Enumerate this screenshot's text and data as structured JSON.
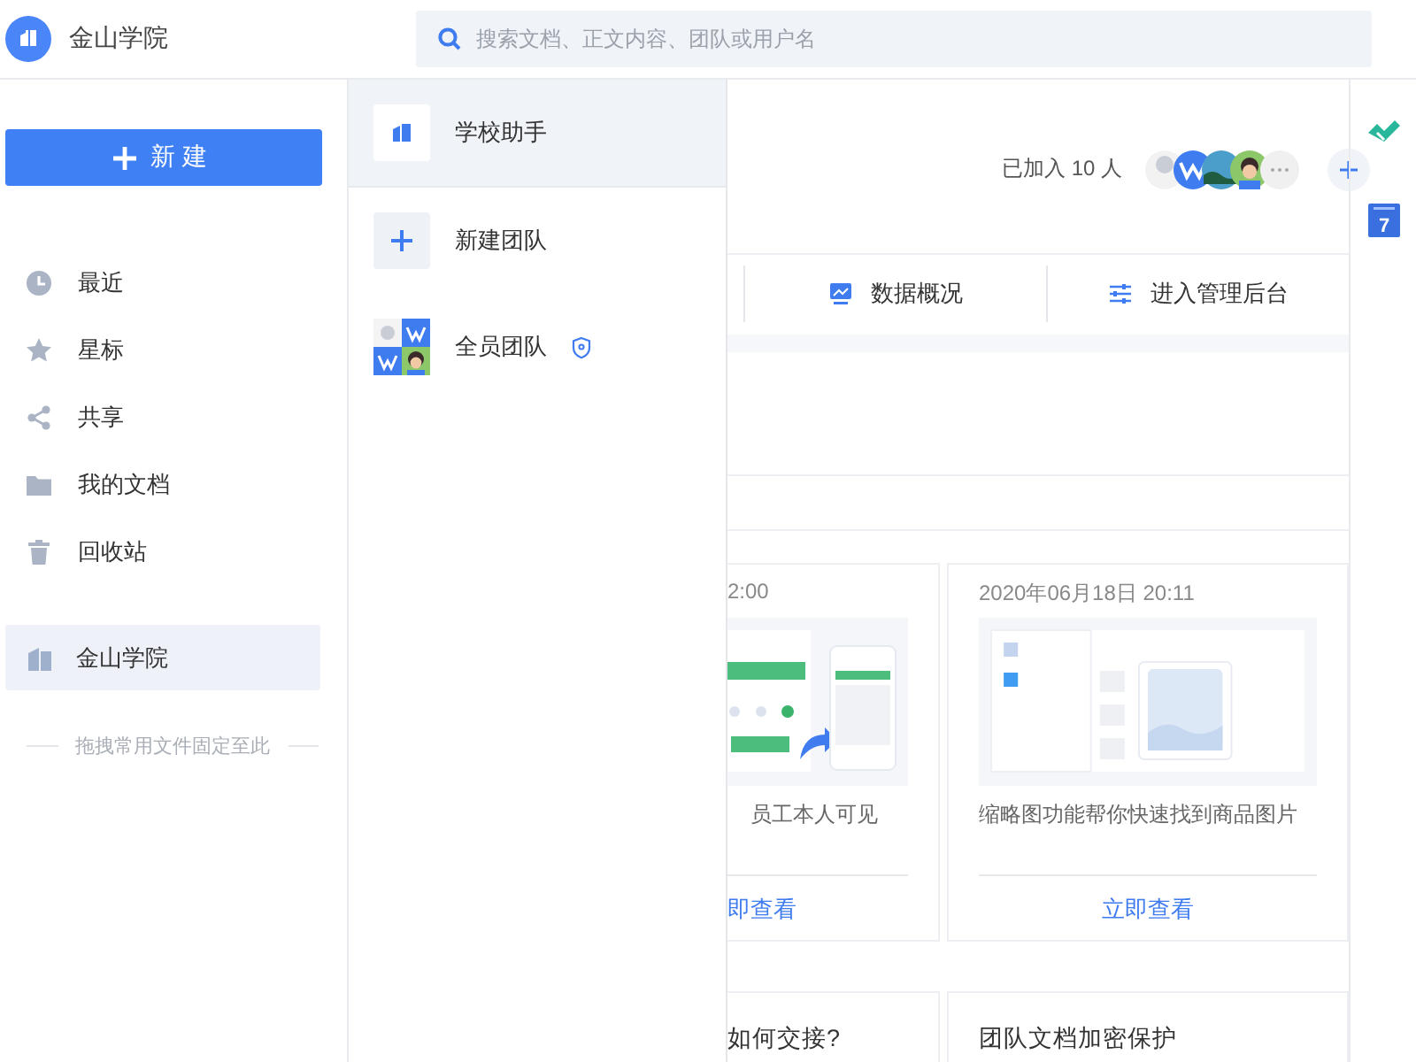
{
  "header": {
    "org_name": "金山学院",
    "search": {
      "placeholder": "搜索文档、正文内容、团队或用户名"
    }
  },
  "sidebar": {
    "new_button": "新建",
    "nav": [
      {
        "label": "最近",
        "selected": false
      },
      {
        "label": "星标",
        "selected": false
      },
      {
        "label": "共享",
        "selected": false
      },
      {
        "label": "我的文档",
        "selected": false
      },
      {
        "label": "回收站",
        "selected": false
      }
    ],
    "teams": [
      {
        "label": "金山学院",
        "selected": true
      }
    ],
    "pin_hint": "拖拽常用文件固定至此"
  },
  "team_menu": {
    "items": [
      {
        "kind": "team",
        "label": "学校助手",
        "selected": true,
        "secured": false
      },
      {
        "kind": "create",
        "label": "新建团队",
        "selected": false,
        "secured": false
      },
      {
        "kind": "group",
        "label": "全员团队",
        "selected": false,
        "secured": true
      }
    ]
  },
  "team_page": {
    "members": {
      "summary": "已加入 10 人"
    },
    "tabs": [
      {
        "label": "数据概况"
      },
      {
        "label": "进入管理后台"
      }
    ],
    "cards": [
      {
        "date": "2:00",
        "description": "员工本人可见",
        "link": "即查看"
      },
      {
        "date": "2020年06月18日 20:11",
        "description": "缩略图功能帮你快速找到商品图片",
        "link": "立即查看"
      }
    ],
    "more_cards": [
      {
        "title": "如何交接?"
      },
      {
        "title": "团队文档加密保护"
      }
    ]
  },
  "rail": {
    "calendar_day": "7"
  }
}
